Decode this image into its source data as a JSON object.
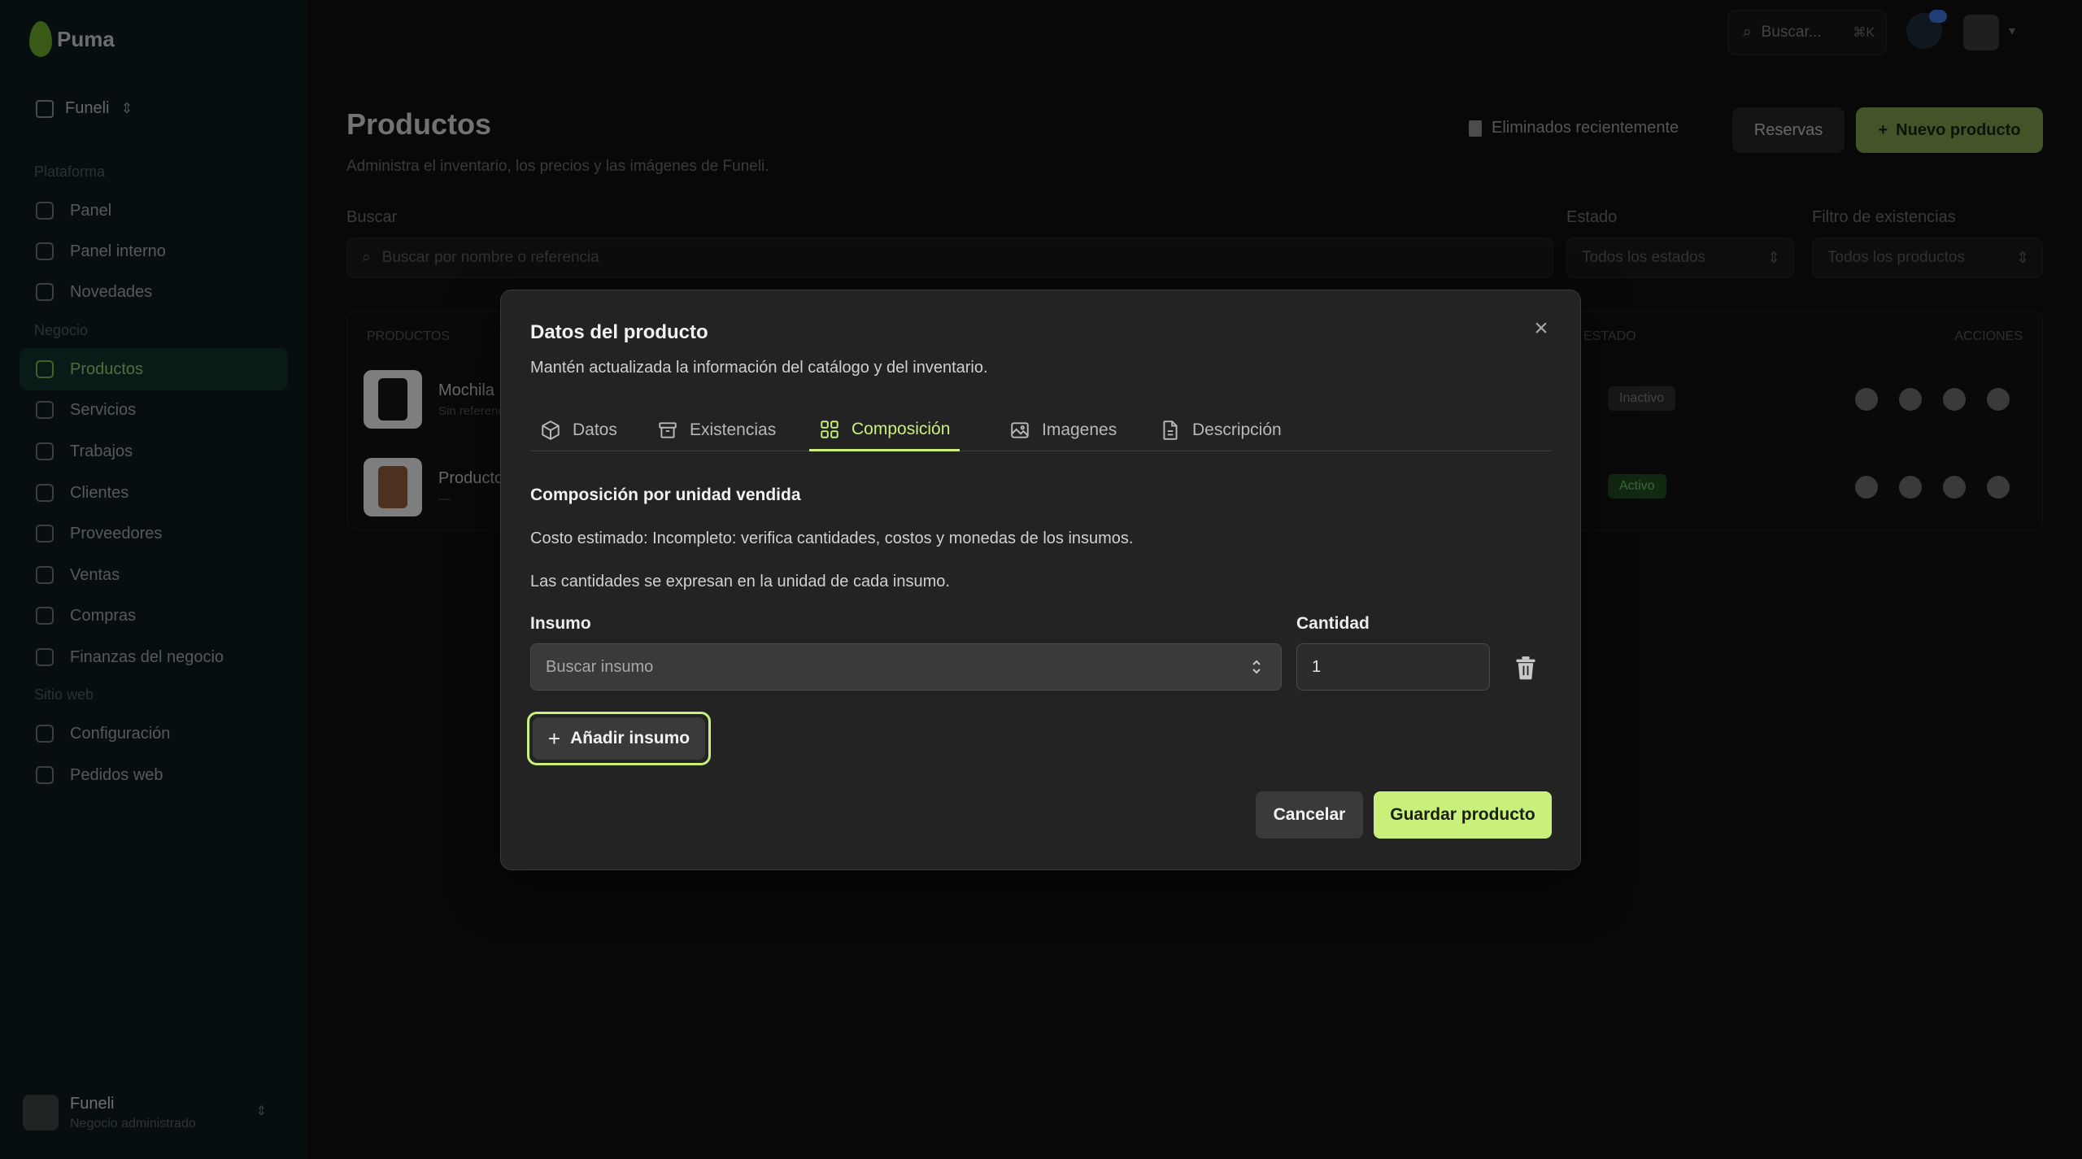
{
  "app": {
    "brand": "Puma"
  },
  "sidebar": {
    "org_name": "Funeli",
    "section_platform": "Plataforma",
    "section_business": "Negocio",
    "section_web": "Sitio web",
    "items": [
      {
        "label": "Panel",
        "icon": "home-icon"
      },
      {
        "label": "Panel interno",
        "icon": "dashboard-icon"
      },
      {
        "label": "Novedades",
        "icon": "megaphone-icon"
      },
      {
        "label": "Productos",
        "icon": "box-icon",
        "active": true
      },
      {
        "label": "Servicios",
        "icon": "wrench-icon"
      },
      {
        "label": "Trabajos",
        "icon": "briefcase-icon"
      },
      {
        "label": "Clientes",
        "icon": "users-icon"
      },
      {
        "label": "Proveedores",
        "icon": "truck-icon"
      },
      {
        "label": "Ventas",
        "icon": "receipt-icon"
      },
      {
        "label": "Compras",
        "icon": "cart-icon"
      },
      {
        "label": "Finanzas del negocio",
        "icon": "finance-icon"
      },
      {
        "label": "Configuración",
        "icon": "gear-icon"
      },
      {
        "label": "Pedidos web",
        "icon": "bag-icon"
      }
    ],
    "user": {
      "name": "Funeli",
      "subtitle": "Negocio administrado"
    }
  },
  "topbar": {
    "search_placeholder": "Buscar...",
    "search_shortcut": "⌘K"
  },
  "page": {
    "title": "Productos",
    "subtitle": "Administra el inventario, los precios y las imágenes de Funeli.",
    "deleted_link": "Eliminados recientemente",
    "reserves_button": "Reservas",
    "new_button": "Nuevo producto",
    "search_label": "Buscar",
    "search_placeholder": "Buscar por nombre o referencia",
    "status_label": "Estado",
    "status_value": "Todos los estados",
    "stock_label": "Filtro de existencias",
    "stock_value": "Todos los productos",
    "table": {
      "col_products": "PRODUCTOS",
      "col_status": "ESTADO",
      "col_actions": "ACCIONES",
      "rows": [
        {
          "name": "Mochila",
          "sku": "Sin referencia",
          "status": "Inactivo"
        },
        {
          "name": "Producto",
          "sku": "—",
          "status": "Activo"
        }
      ]
    }
  },
  "modal": {
    "title": "Datos del producto",
    "description": "Mantén actualizada la información del catálogo y del inventario.",
    "tabs": [
      {
        "label": "Datos",
        "icon": "cube-icon"
      },
      {
        "label": "Existencias",
        "icon": "archive-icon"
      },
      {
        "label": "Composición",
        "icon": "grid-icon",
        "active": true
      },
      {
        "label": "Imagenes",
        "icon": "image-icon"
      },
      {
        "label": "Descripción",
        "icon": "document-icon"
      }
    ],
    "composition": {
      "section_title": "Composición por unidad vendida",
      "cost_text": "Costo estimado: Incompleto: verifica cantidades, costos y monedas de los insumos.",
      "units_text": "Las cantidades se expresan en la unidad de cada insumo.",
      "insumo_label": "Insumo",
      "insumo_placeholder": "Buscar insumo",
      "quantity_label": "Cantidad",
      "quantity_value": "1",
      "add_button": "Añadir insumo"
    },
    "cancel_button": "Cancelar",
    "save_button": "Guardar producto"
  },
  "colors": {
    "accent": "#c8f07a",
    "modal_bg": "#232323",
    "sidebar_bg": "#0b1a1e"
  }
}
